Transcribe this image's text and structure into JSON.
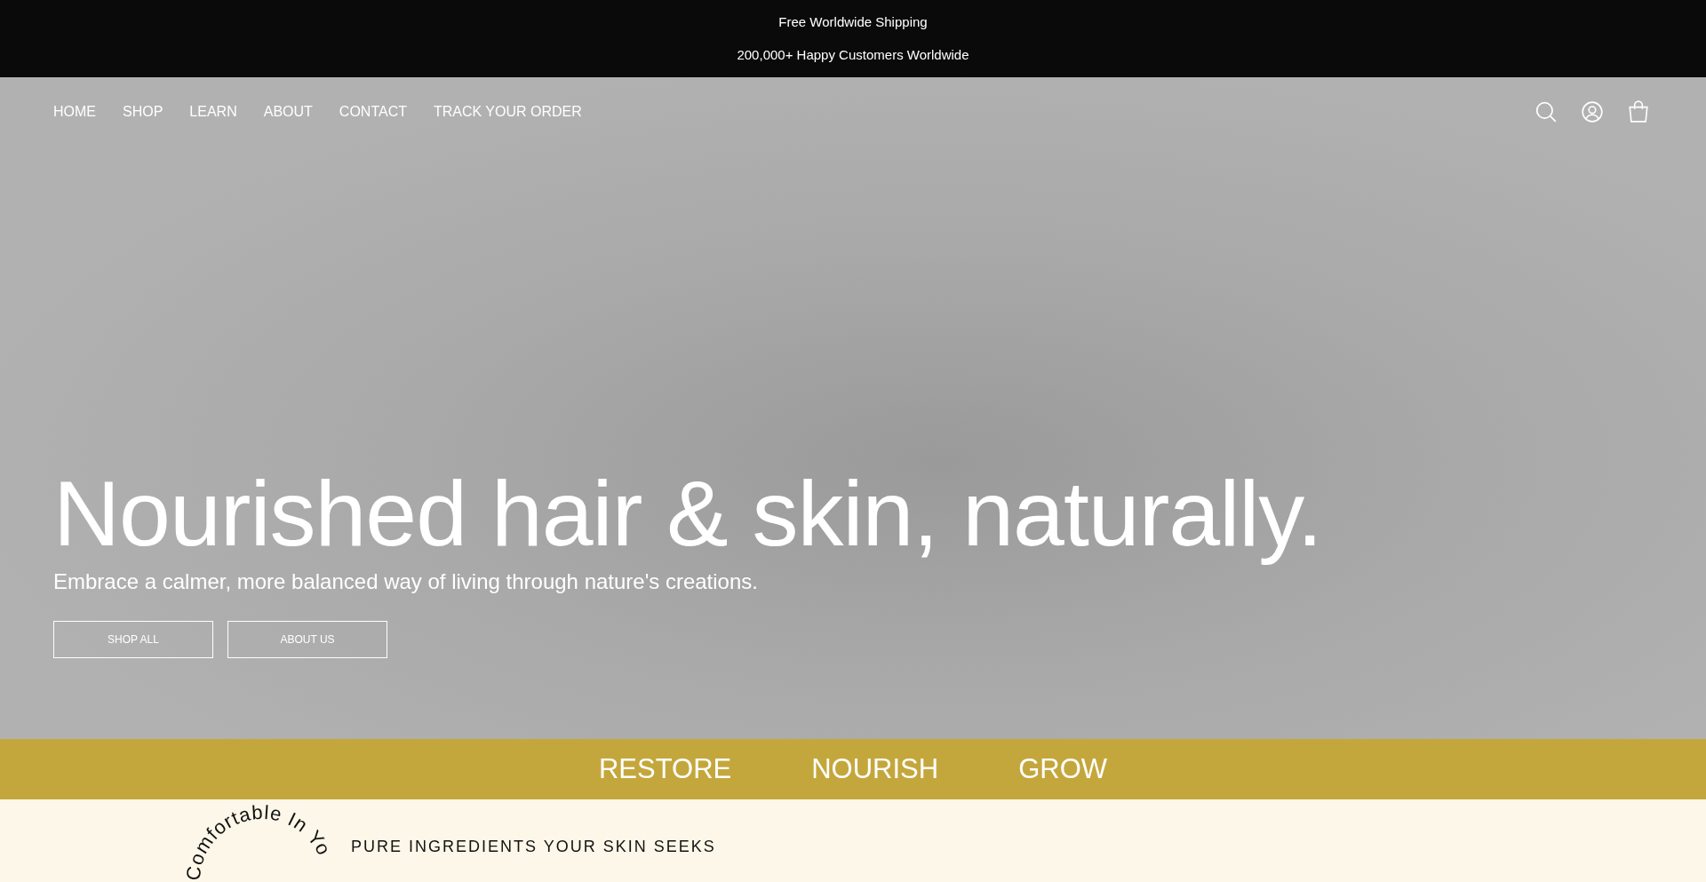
{
  "announcements": [
    "Free Worldwide Shipping",
    "200,000+ Happy Customers Worldwide"
  ],
  "nav": {
    "links": [
      "HOME",
      "SHOP",
      "LEARN",
      "ABOUT",
      "CONTACT",
      "TRACK YOUR ORDER"
    ]
  },
  "hero": {
    "title": "Nourished hair & skin, naturally.",
    "subtitle": "Embrace a calmer, more balanced way of living through nature's creations.",
    "buttons": [
      "SHOP ALL",
      "ABOUT US"
    ]
  },
  "band": {
    "words": [
      "RESTORE",
      "NOURISH",
      "GROW"
    ]
  },
  "intro": {
    "circle_text": "Comfortable In Yo",
    "heading": "PURE INGREDIENTS YOUR SKIN SEEKS"
  }
}
